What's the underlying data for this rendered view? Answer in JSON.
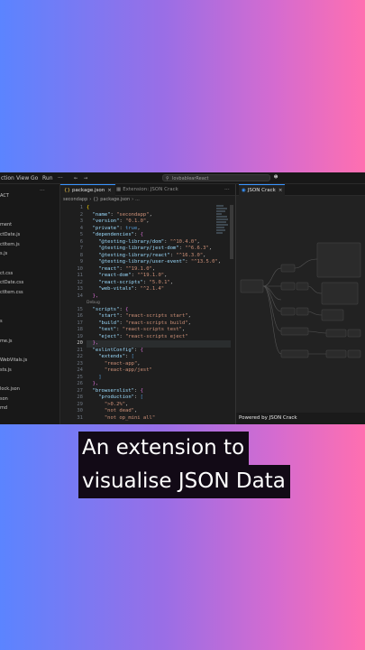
{
  "menu": [
    "ction",
    "View",
    "Go",
    "Run",
    "···"
  ],
  "titlebar": {
    "search_text": "lovbablearReact",
    "search_icon": "search-icon",
    "account_icon": "account-icon"
  },
  "sidebar": {
    "items": [
      "ACT",
      "",
      "",
      "ment",
      "ctDate.js",
      "ctItem.js",
      "s.js",
      "",
      "ct.css",
      "ctDate.css",
      "ctItem.css",
      "",
      "",
      "s",
      "",
      "me.js",
      "",
      "WebVitals.js",
      "sts.js",
      "",
      "lock.json",
      "son",
      "md"
    ]
  },
  "tabs": [
    {
      "label": "package.json",
      "active": true,
      "close": "×"
    },
    {
      "label": "Extension: JSON Crack",
      "active": false
    }
  ],
  "breadcrumb": [
    "secondapp",
    "{} package.json",
    "..."
  ],
  "editor": {
    "line_numbers": [
      "1",
      "2",
      "3",
      "4",
      "5",
      "6",
      "7",
      "8",
      "9",
      "10",
      "11",
      "12",
      "13",
      "14",
      "",
      "15",
      "16",
      "17",
      "18",
      "19",
      "20",
      "21",
      "22",
      "23",
      "24",
      "25",
      "26",
      "27",
      "28",
      "29",
      "30",
      "31"
    ],
    "current_line": "20",
    "lens_text": "Debug",
    "lines": [
      [
        {
          "t": "{",
          "c": "y"
        }
      ],
      [
        {
          "t": "  \"name\"",
          "c": "k"
        },
        {
          "t": ": ",
          "c": "p"
        },
        {
          "t": "\"secondapp\"",
          "c": "s"
        },
        {
          "t": ",",
          "c": "p"
        }
      ],
      [
        {
          "t": "  \"version\"",
          "c": "k"
        },
        {
          "t": ": ",
          "c": "p"
        },
        {
          "t": "\"0.1.0\"",
          "c": "s"
        },
        {
          "t": ",",
          "c": "p"
        }
      ],
      [
        {
          "t": "  \"private\"",
          "c": "k"
        },
        {
          "t": ": ",
          "c": "p"
        },
        {
          "t": "true",
          "c": "b"
        },
        {
          "t": ",",
          "c": "p"
        }
      ],
      [
        {
          "t": "  \"dependencies\"",
          "c": "k"
        },
        {
          "t": ": ",
          "c": "p"
        },
        {
          "t": "{",
          "c": "pk"
        }
      ],
      [
        {
          "t": "    \"@testing-library/dom\"",
          "c": "k"
        },
        {
          "t": ": ",
          "c": "p"
        },
        {
          "t": "\"^10.4.0\"",
          "c": "s"
        },
        {
          "t": ",",
          "c": "p"
        }
      ],
      [
        {
          "t": "    \"@testing-library/jest-dom\"",
          "c": "k"
        },
        {
          "t": ": ",
          "c": "p"
        },
        {
          "t": "\"^6.6.3\"",
          "c": "s"
        },
        {
          "t": ",",
          "c": "p"
        }
      ],
      [
        {
          "t": "    \"@testing-library/react\"",
          "c": "k"
        },
        {
          "t": ": ",
          "c": "p"
        },
        {
          "t": "\"^16.3.0\"",
          "c": "s"
        },
        {
          "t": ",",
          "c": "p"
        }
      ],
      [
        {
          "t": "    \"@testing-library/user-event\"",
          "c": "k"
        },
        {
          "t": ": ",
          "c": "p"
        },
        {
          "t": "\"^13.5.0\"",
          "c": "s"
        },
        {
          "t": ",",
          "c": "p"
        }
      ],
      [
        {
          "t": "    \"react\"",
          "c": "k"
        },
        {
          "t": ": ",
          "c": "p"
        },
        {
          "t": "\"^19.1.0\"",
          "c": "s"
        },
        {
          "t": ",",
          "c": "p"
        }
      ],
      [
        {
          "t": "    \"react-dom\"",
          "c": "k"
        },
        {
          "t": ": ",
          "c": "p"
        },
        {
          "t": "\"^19.1.0\"",
          "c": "s"
        },
        {
          "t": ",",
          "c": "p"
        }
      ],
      [
        {
          "t": "    \"react-scripts\"",
          "c": "k"
        },
        {
          "t": ": ",
          "c": "p"
        },
        {
          "t": "\"5.0.1\"",
          "c": "s"
        },
        {
          "t": ",",
          "c": "p"
        }
      ],
      [
        {
          "t": "    \"web-vitals\"",
          "c": "k"
        },
        {
          "t": ": ",
          "c": "p"
        },
        {
          "t": "\"^2.1.4\"",
          "c": "s"
        }
      ],
      [
        {
          "t": "  },",
          "c": "pk"
        }
      ],
      [
        {
          "t": "Debug",
          "c": "lens"
        }
      ],
      [
        {
          "t": "  \"scripts\"",
          "c": "k"
        },
        {
          "t": ": ",
          "c": "p"
        },
        {
          "t": "{",
          "c": "pk"
        }
      ],
      [
        {
          "t": "    \"start\"",
          "c": "k"
        },
        {
          "t": ": ",
          "c": "p"
        },
        {
          "t": "\"react-scripts start\"",
          "c": "s"
        },
        {
          "t": ",",
          "c": "p"
        }
      ],
      [
        {
          "t": "    \"build\"",
          "c": "k"
        },
        {
          "t": ": ",
          "c": "p"
        },
        {
          "t": "\"react-scripts build\"",
          "c": "s"
        },
        {
          "t": ",",
          "c": "p"
        }
      ],
      [
        {
          "t": "    \"test\"",
          "c": "k"
        },
        {
          "t": ": ",
          "c": "p"
        },
        {
          "t": "\"react-scripts test\"",
          "c": "s"
        },
        {
          "t": ",",
          "c": "p"
        }
      ],
      [
        {
          "t": "    \"eject\"",
          "c": "k"
        },
        {
          "t": ": ",
          "c": "p"
        },
        {
          "t": "\"react-scripts eject\"",
          "c": "s"
        }
      ],
      [
        {
          "t": "  },",
          "c": "pk"
        }
      ],
      [
        {
          "t": "  \"eslintConfig\"",
          "c": "k"
        },
        {
          "t": ": ",
          "c": "p"
        },
        {
          "t": "{",
          "c": "pk"
        }
      ],
      [
        {
          "t": "    \"extends\"",
          "c": "k"
        },
        {
          "t": ": ",
          "c": "p"
        },
        {
          "t": "[",
          "c": "b"
        }
      ],
      [
        {
          "t": "      \"react-app\"",
          "c": "s"
        },
        {
          "t": ",",
          "c": "p"
        }
      ],
      [
        {
          "t": "      \"react-app/jest\"",
          "c": "s"
        }
      ],
      [
        {
          "t": "    ]",
          "c": "b"
        }
      ],
      [
        {
          "t": "  },",
          "c": "pk"
        }
      ],
      [
        {
          "t": "  \"browserslist\"",
          "c": "k"
        },
        {
          "t": ": ",
          "c": "p"
        },
        {
          "t": "{",
          "c": "pk"
        }
      ],
      [
        {
          "t": "    \"production\"",
          "c": "k"
        },
        {
          "t": ": ",
          "c": "p"
        },
        {
          "t": "[",
          "c": "b"
        }
      ],
      [
        {
          "t": "      \">0.2%\"",
          "c": "s"
        },
        {
          "t": ",",
          "c": "p"
        }
      ],
      [
        {
          "t": "      \"not dead\"",
          "c": "s"
        },
        {
          "t": ",",
          "c": "p"
        }
      ],
      [
        {
          "t": "      \"not op_mini all\"",
          "c": "s"
        }
      ]
    ]
  },
  "panel": {
    "tab_label": "JSON Crack",
    "tab_icon": "json-crack-icon",
    "footer": "Powered by JSON Crack"
  },
  "caption": {
    "line1": "An extension to",
    "line2": "visualise JSON Data"
  },
  "colors": {
    "accent": "#3794ff",
    "node_border": "#4a4a4a",
    "edge": "#555555"
  }
}
